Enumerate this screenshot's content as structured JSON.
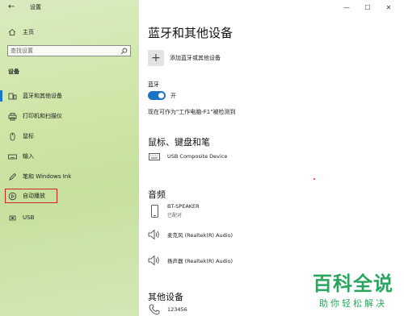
{
  "window": {
    "title": "设置",
    "back_symbol": "←",
    "controls": {
      "minimize": "—",
      "maximize": "☐",
      "close": "✕"
    }
  },
  "sidebar": {
    "home_label": "主页",
    "search_placeholder": "查找设置",
    "section_label": "设备",
    "items": [
      {
        "label": "蓝牙和其他设备",
        "icon": "bluetooth-devices-icon",
        "active": true
      },
      {
        "label": "打印机和扫描仪",
        "icon": "printer-icon",
        "active": false
      },
      {
        "label": "鼠标",
        "icon": "mouse-icon",
        "active": false
      },
      {
        "label": "输入",
        "icon": "keyboard-icon",
        "active": false
      },
      {
        "label": "笔和 Windows Ink",
        "icon": "pen-icon",
        "active": false
      },
      {
        "label": "自动播放",
        "icon": "autoplay-icon",
        "active": false,
        "highlighted": true
      },
      {
        "label": "USB",
        "icon": "usb-icon",
        "active": false
      }
    ]
  },
  "main": {
    "page_title": "蓝牙和其他设备",
    "add_device_label": "添加蓝牙或其他设备",
    "bluetooth": {
      "label": "蓝牙",
      "toggle_state": "开",
      "discoverable_text": "现在可作为\"工作电脑-F1\"被检测到"
    },
    "sections": {
      "input": {
        "title": "鼠标、键盘和笔",
        "devices": [
          {
            "name": "USB Composite Device",
            "status": ""
          }
        ]
      },
      "audio": {
        "title": "音频",
        "devices": [
          {
            "name": "BT-SPEAKER",
            "status": "已配对"
          },
          {
            "name": "麦克风 (Realtek(R) Audio)",
            "status": ""
          },
          {
            "name": "扬声器 (Realtek(R) Audio)",
            "status": ""
          }
        ]
      },
      "other": {
        "title": "其他设备",
        "devices": [
          {
            "name": "123456",
            "status": ""
          }
        ]
      }
    }
  },
  "watermark": {
    "line1": "百科全说",
    "line2": "助你轻松解决"
  },
  "colors": {
    "accent": "#1a73c7",
    "highlight_border": "#d0232a",
    "watermark": "#28a55e"
  }
}
